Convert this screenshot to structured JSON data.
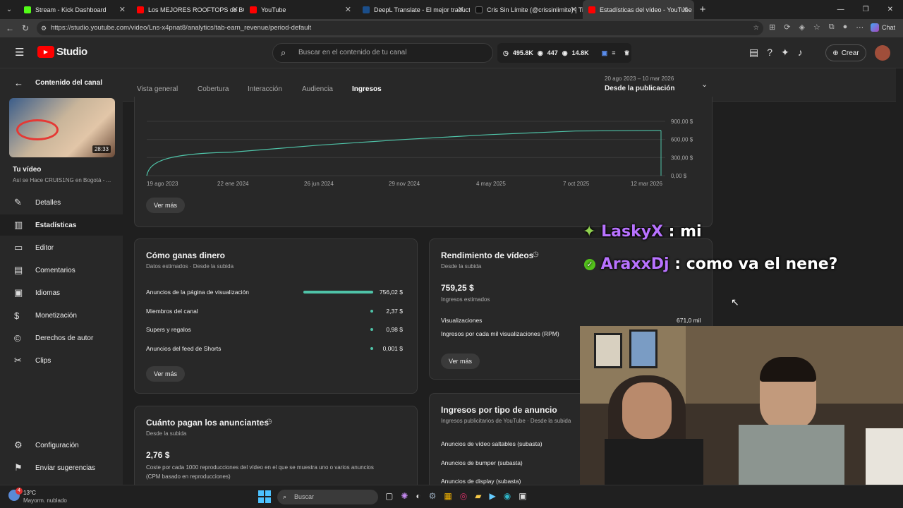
{
  "browser": {
    "tabs": [
      {
        "title": "Stream - Kick Dashboard",
        "color": "#53fc18"
      },
      {
        "title": "Los MEJORES ROOFTOPS de BOGO",
        "color": "#ff0000"
      },
      {
        "title": "YouTube",
        "color": "#ff0000"
      },
      {
        "title": "DeepL Translate - El mejor traductor",
        "color": "#0f2b46"
      },
      {
        "title": "Cris Sin Límite (@crissinlimite) | Ti",
        "color": "#222222"
      },
      {
        "title": "Estadísticas del vídeo - YouTube St",
        "color": "#ff0000"
      }
    ],
    "url": "https://studio.youtube.com/video/Lns-x4pnat8/analytics/tab-earn_revenue/period-default",
    "chat_label": "Chat"
  },
  "header": {
    "logo": "Studio",
    "search_placeholder": "Buscar en el contenido de tu canal",
    "stats": [
      "495.8K",
      "447",
      "14.8K"
    ],
    "create": "Crear"
  },
  "sidebar": {
    "back_title": "Contenido del canal",
    "duration": "28:33",
    "video_label": "Tu vídeo",
    "video_title": "Así se Hace CRUIS1NG en Bogotá - ...",
    "items": [
      {
        "label": "Detalles",
        "icon": "pencil-icon"
      },
      {
        "label": "Estadísticas",
        "icon": "analytics-icon"
      },
      {
        "label": "Editor",
        "icon": "editor-icon"
      },
      {
        "label": "Comentarios",
        "icon": "comments-icon"
      },
      {
        "label": "Idiomas",
        "icon": "subtitles-icon"
      },
      {
        "label": "Monetización",
        "icon": "dollar-icon"
      },
      {
        "label": "Derechos de autor",
        "icon": "copyright-icon"
      },
      {
        "label": "Clips",
        "icon": "scissors-icon"
      }
    ],
    "bottom": [
      "Configuración",
      "Enviar sugerencias"
    ]
  },
  "tabs": [
    "Vista general",
    "Cobertura",
    "Interacción",
    "Audiencia",
    "Ingresos"
  ],
  "period": {
    "range": "20 ago 2023 – 10 mar 2026",
    "label": "Desde la publicación"
  },
  "chart_data": {
    "type": "line",
    "x": [
      "19 ago 2023",
      "22 ene 2024",
      "26 jun 2024",
      "29 nov 2024",
      "4 may 2025",
      "7 oct 2025",
      "12 mar 2026"
    ],
    "series": [
      {
        "values": [
          0,
          390,
          505,
          600,
          680,
          740,
          750
        ]
      }
    ],
    "yticks": [
      "900,00 $",
      "600,00 $",
      "300,00 $",
      "0,00 $"
    ],
    "ylim": [
      0,
      900
    ],
    "color": "#4fc3a8"
  },
  "ver_mas": "Ver más",
  "earn": {
    "title": "Cómo ganas dinero",
    "sub": "Datos estimados · Desde la subida",
    "rows": [
      {
        "label": "Anuncios de la página de visualización",
        "value": "756,02 $",
        "share": 0.995
      },
      {
        "label": "Miembros del canal",
        "value": "2,37 $",
        "share": 0.003
      },
      {
        "label": "Supers y regalos",
        "value": "0,98 $",
        "share": 0.001
      },
      {
        "label": "Anuncios del feed de Shorts",
        "value": "0,001 $",
        "share": 0
      }
    ]
  },
  "perf": {
    "title": "Rendimiento de vídeos",
    "sub": "Desde la subida",
    "amount": "759,25 $",
    "amount_label": "Ingresos estimados",
    "views_label": "Visualizaciones",
    "views": "671,0 mil",
    "rpm_label": "Ingresos por cada mil visualizaciones (RPM)"
  },
  "advertisers": {
    "title": "Cuánto pagan los anunciantes",
    "sub": "Desde la subida",
    "value": "2,76 $",
    "desc1": "Coste por cada 1000 reproducciones del vídeo en el que se muestra uno o varios anuncios",
    "desc2": "(CPM basado en reproducciones)"
  },
  "adtype": {
    "title": "Ingresos por tipo de anuncio",
    "sub": "Ingresos publicitarios de YouTube · Desde la subida",
    "rows": [
      "Anuncios de vídeo saltables (subasta)",
      "Anuncios de bumper (subasta)",
      "Anuncios de display (subasta)"
    ]
  },
  "chat": [
    {
      "user": "LaskyX",
      "msg": " : mi",
      "color": "#b872ff"
    },
    {
      "user": "AraxxDj",
      "msg": " : como va el nene?",
      "color": "#b872ff"
    }
  ],
  "taskbar": {
    "temp": "13°C",
    "weather": "Mayorm. nublado",
    "search": "Buscar",
    "badge": "4"
  }
}
